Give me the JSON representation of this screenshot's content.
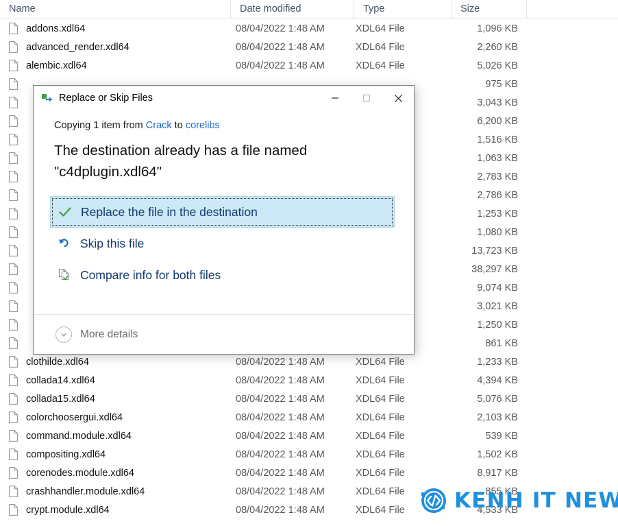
{
  "explorer": {
    "columns": [
      {
        "key": "name",
        "label": "Name"
      },
      {
        "key": "date",
        "label": "Date modified"
      },
      {
        "key": "type",
        "label": "Type"
      },
      {
        "key": "size",
        "label": "Size"
      }
    ],
    "rows": [
      {
        "name": "addons.xdl64",
        "date": "08/04/2022 1:48 AM",
        "type": "XDL64 File",
        "size": "1,096 KB",
        "obscured": false
      },
      {
        "name": "advanced_render.xdl64",
        "date": "08/04/2022 1:48 AM",
        "type": "XDL64 File",
        "size": "2,260 KB",
        "obscured": false
      },
      {
        "name": "alembic.xdl64",
        "date": "08/04/2022 1:48 AM",
        "type": "XDL64 File",
        "size": "5,026 KB",
        "obscured": false
      },
      {
        "name": "",
        "date": "",
        "type": "",
        "size": "975 KB",
        "obscured": true
      },
      {
        "name": "",
        "date": "",
        "type": "",
        "size": "3,043 KB",
        "obscured": true
      },
      {
        "name": "",
        "date": "",
        "type": "",
        "size": "6,200 KB",
        "obscured": true
      },
      {
        "name": "",
        "date": "",
        "type": "",
        "size": "1,516 KB",
        "obscured": true
      },
      {
        "name": "",
        "date": "",
        "type": "",
        "size": "1,063 KB",
        "obscured": true
      },
      {
        "name": "",
        "date": "",
        "type": "",
        "size": "2,783 KB",
        "obscured": true
      },
      {
        "name": "",
        "date": "",
        "type": "",
        "size": "2,786 KB",
        "obscured": true
      },
      {
        "name": "",
        "date": "",
        "type": "",
        "size": "1,253 KB",
        "obscured": true
      },
      {
        "name": "",
        "date": "",
        "type": "",
        "size": "1,080 KB",
        "obscured": true
      },
      {
        "name": "",
        "date": "",
        "type": "",
        "size": "13,723 KB",
        "obscured": true
      },
      {
        "name": "",
        "date": "",
        "type": "",
        "size": "38,297 KB",
        "obscured": true
      },
      {
        "name": "",
        "date": "",
        "type": "",
        "size": "9,074 KB",
        "obscured": true
      },
      {
        "name": "",
        "date": "",
        "type": "",
        "size": "3,021 KB",
        "obscured": true
      },
      {
        "name": "",
        "date": "",
        "type": "",
        "size": "1,250 KB",
        "obscured": true
      },
      {
        "name": "",
        "date": "",
        "type": "",
        "size": "861 KB",
        "obscured": true
      },
      {
        "name": "clothilde.xdl64",
        "date": "08/04/2022 1:48 AM",
        "type": "XDL64 File",
        "size": "1,233 KB",
        "obscured": false
      },
      {
        "name": "collada14.xdl64",
        "date": "08/04/2022 1:48 AM",
        "type": "XDL64 File",
        "size": "4,394 KB",
        "obscured": false
      },
      {
        "name": "collada15.xdl64",
        "date": "08/04/2022 1:48 AM",
        "type": "XDL64 File",
        "size": "5,076 KB",
        "obscured": false
      },
      {
        "name": "colorchoosergui.xdl64",
        "date": "08/04/2022 1:48 AM",
        "type": "XDL64 File",
        "size": "2,103 KB",
        "obscured": false
      },
      {
        "name": "command.module.xdl64",
        "date": "08/04/2022 1:48 AM",
        "type": "XDL64 File",
        "size": "539 KB",
        "obscured": false
      },
      {
        "name": "compositing.xdl64",
        "date": "08/04/2022 1:48 AM",
        "type": "XDL64 File",
        "size": "1,502 KB",
        "obscured": false
      },
      {
        "name": "corenodes.module.xdl64",
        "date": "08/04/2022 1:48 AM",
        "type": "XDL64 File",
        "size": "8,917 KB",
        "obscured": false
      },
      {
        "name": "crashhandler.module.xdl64",
        "date": "08/04/2022 1:48 AM",
        "type": "XDL64 File",
        "size": "855 KB",
        "obscured": false
      },
      {
        "name": "crypt.module.xdl64",
        "date": "08/04/2022 1:48 AM",
        "type": "XDL64 File",
        "size": "4,533 KB",
        "obscured": false
      }
    ]
  },
  "dialog": {
    "title": "Replace or Skip Files",
    "title_icon": "copy-files-icon",
    "window_controls": {
      "minimize": "minimize-icon",
      "maximize": "maximize-icon",
      "close": "close-icon"
    },
    "copy_line": {
      "prefix": "Copying 1 item from ",
      "source": "Crack",
      "middle": " to ",
      "destination": "corelibs"
    },
    "headline": "The destination already has a file named \"c4dplugin.xdl64\"",
    "options": [
      {
        "label": "Replace the file in the destination",
        "icon": "green-check-icon",
        "selected": true
      },
      {
        "label": "Skip this file",
        "icon": "skip-undo-arrow-icon",
        "selected": false
      },
      {
        "label": "Compare info for both files",
        "icon": "compare-files-icon",
        "selected": false
      }
    ],
    "footer": {
      "more_details_label": "More details",
      "more_details_icon": "chevron-down-circle-icon"
    },
    "colors": {
      "selection_fill": "#cde8f6",
      "selection_border": "#a9d4ea",
      "link": "#1f68c4",
      "option_text": "#14396e",
      "check_green": "#3aa23a",
      "arrow_blue": "#1f6fc0"
    }
  },
  "watermark": {
    "text": "KENH IT NEWS",
    "icon": "code-brackets-circle-logo",
    "color": "#1f8fe0"
  }
}
